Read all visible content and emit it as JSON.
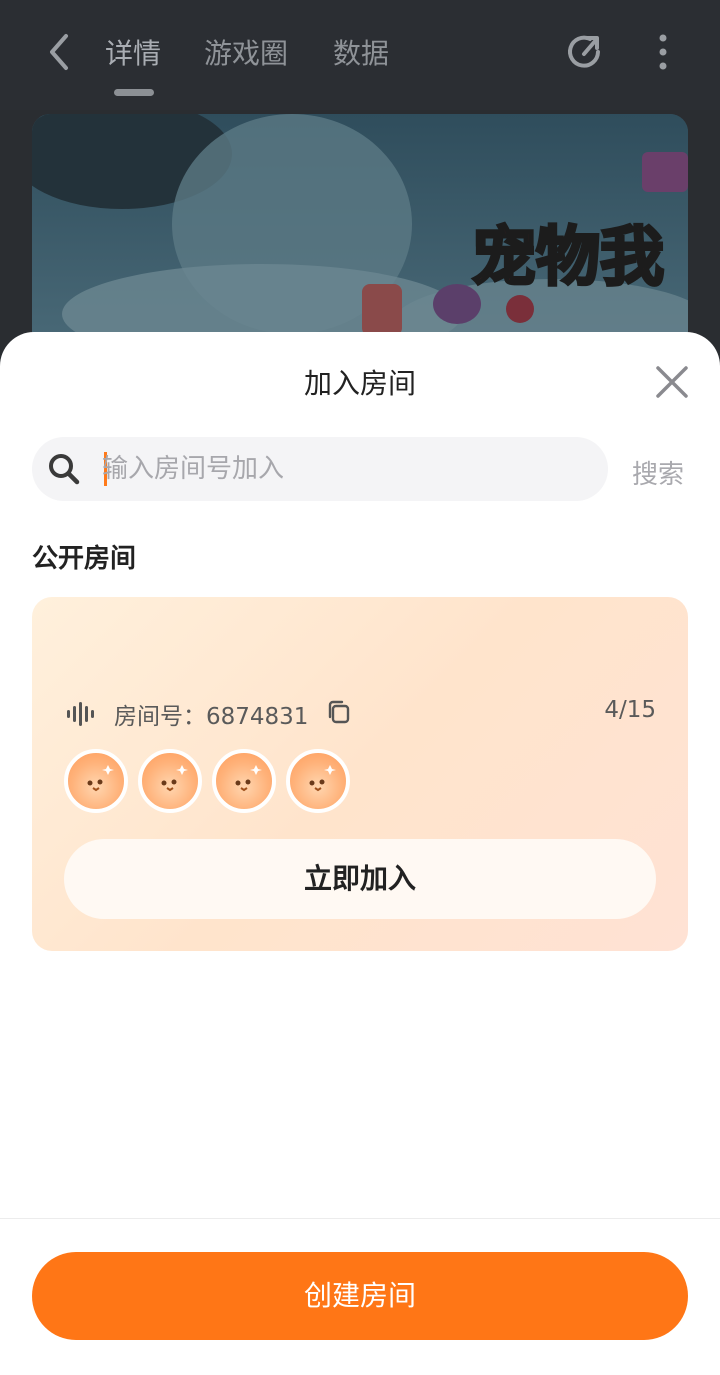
{
  "nav": {
    "tabs": [
      {
        "label": "详情"
      },
      {
        "label": "游戏圈"
      },
      {
        "label": "数据"
      }
    ]
  },
  "banner": {
    "title_text": "宠物我"
  },
  "sheet": {
    "title": "加入房间",
    "search": {
      "placeholder": "输入房间号加入",
      "button_label": "搜索"
    },
    "section_title": "公开房间",
    "room": {
      "id_label": "房间号：6874831",
      "count": "4/15",
      "avatars": [
        {
          "icon": "chick-avatar"
        },
        {
          "icon": "chick-avatar"
        },
        {
          "icon": "chick-avatar"
        },
        {
          "icon": "chick-avatar"
        }
      ],
      "join_label": "立即加入"
    },
    "create_label": "创建房间"
  },
  "colors": {
    "accent": "#ff7616",
    "card_bg": "#ffe6cf"
  }
}
